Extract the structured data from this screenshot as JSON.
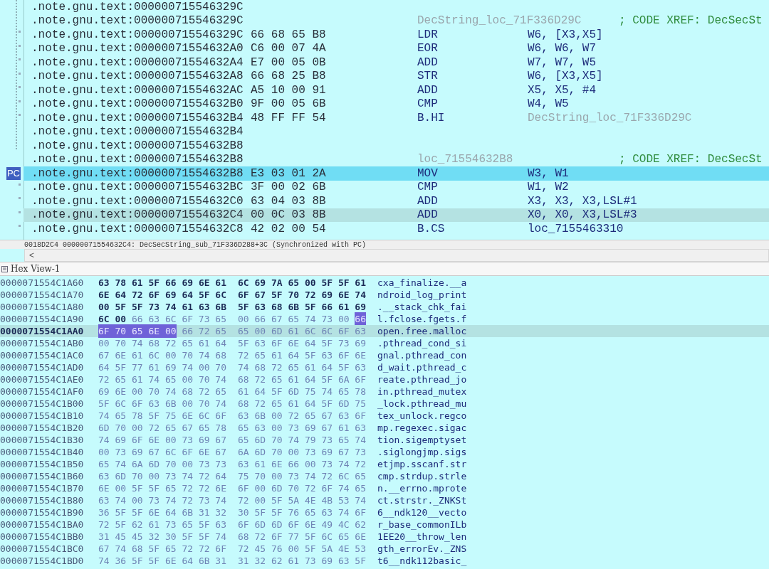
{
  "disassembly": {
    "pc_label": "PC",
    "rows": [
      {
        "address": ".note.gnu.text:000000715546329C",
        "marker": false,
        "pc": false,
        "selected": false
      },
      {
        "address": ".note.gnu.text:000000715546329C",
        "label": "DecString_loc_71F336D29C",
        "comment": "; CODE XREF: DecSecSt",
        "marker": false,
        "pc": false,
        "selected": false
      },
      {
        "address": ".note.gnu.text:000000715546329C",
        "bytes": "66 68 65 B8",
        "mnemonic": "LDR",
        "operand": {
          "text": "W6, [X3,X5]",
          "kind": "register"
        },
        "marker": true,
        "pc": false,
        "selected": false
      },
      {
        "address": ".note.gnu.text:00000071554632A0",
        "bytes": "C6 00 07 4A",
        "mnemonic": "EOR",
        "operand": {
          "text": "W6, W6, W7",
          "kind": "register"
        },
        "marker": true,
        "pc": false,
        "selected": false
      },
      {
        "address": ".note.gnu.text:00000071554632A4",
        "bytes": "E7 00 05 0B",
        "mnemonic": "ADD",
        "operand": {
          "text": "W7, W7, W5",
          "kind": "register"
        },
        "marker": true,
        "pc": false,
        "selected": false
      },
      {
        "address": ".note.gnu.text:00000071554632A8",
        "bytes": "66 68 25 B8",
        "mnemonic": "STR",
        "operand": {
          "text": "W6, [X3,X5]",
          "kind": "register"
        },
        "marker": true,
        "pc": false,
        "selected": false
      },
      {
        "address": ".note.gnu.text:00000071554632AC",
        "bytes": "A5 10 00 91",
        "mnemonic": "ADD",
        "operand": {
          "text": "X5, X5, #4",
          "kind": "register"
        },
        "marker": true,
        "pc": false,
        "selected": false
      },
      {
        "address": ".note.gnu.text:00000071554632B0",
        "bytes": "9F 00 05 6B",
        "mnemonic": "CMP",
        "operand": {
          "text": "W4, W5",
          "kind": "register"
        },
        "marker": true,
        "pc": false,
        "selected": false
      },
      {
        "address": ".note.gnu.text:00000071554632B4",
        "bytes": "48 FF FF 54",
        "mnemonic": "B.HI",
        "operand": {
          "text": "DecString_loc_71F336D29C",
          "kind": "reference"
        },
        "marker": true,
        "pc": false,
        "selected": false
      },
      {
        "address": ".note.gnu.text:00000071554632B4",
        "marker": false,
        "pc": false,
        "selected": false
      },
      {
        "address": ".note.gnu.text:00000071554632B8",
        "marker": false,
        "pc": false,
        "selected": false
      },
      {
        "address": ".note.gnu.text:00000071554632B8",
        "label": "loc_71554632B8",
        "comment": "; CODE XREF: DecSecSt",
        "marker": false,
        "pc": false,
        "selected": false
      },
      {
        "address": ".note.gnu.text:00000071554632B8",
        "bytes": "E3 03 01 2A",
        "mnemonic": "MOV",
        "operand": {
          "text": "W3, W1",
          "kind": "register"
        },
        "marker": false,
        "pc": true,
        "selected": false
      },
      {
        "address": ".note.gnu.text:00000071554632BC",
        "bytes": "3F 00 02 6B",
        "mnemonic": "CMP",
        "operand": {
          "text": "W1, W2",
          "kind": "register"
        },
        "marker": true,
        "pc": false,
        "selected": false
      },
      {
        "address": ".note.gnu.text:00000071554632C0",
        "bytes": "63 04 03 8B",
        "mnemonic": "ADD",
        "operand": {
          "text": "X3, X3, X3,LSL#1",
          "kind": "register"
        },
        "marker": true,
        "pc": false,
        "selected": false
      },
      {
        "address": ".note.gnu.text:00000071554632C4",
        "bytes": "00 0C 03 8B",
        "mnemonic": "ADD",
        "operand": {
          "text": "X0, X0, X3,LSL#3",
          "kind": "register"
        },
        "marker": true,
        "pc": false,
        "selected": true
      },
      {
        "address": ".note.gnu.text:00000071554632C8",
        "bytes": "42 02 00 54",
        "mnemonic": "B.CS",
        "operand": {
          "text": "loc_7155463310",
          "kind": "register"
        },
        "marker": true,
        "pc": false,
        "selected": false
      }
    ]
  },
  "status_line": "0018D2C4 00000071554632C4: DecSecString_sub_71F336D288+3C (Synchronized with PC)",
  "scroll_left": "<",
  "hex_view": {
    "title": "Hex View-1",
    "rows": [
      {
        "address": "0000071554C1A60",
        "left": [
          {
            "kind": "changed",
            "text": "63 78 61 5F 66 69 6E 61"
          }
        ],
        "right": [
          {
            "kind": "changed",
            "text": "6C 69 7A 65 00 5F 5F 61"
          }
        ],
        "ascii": "cxa_finalize.__a",
        "selected": false
      },
      {
        "address": "0000071554C1A70",
        "left": [
          {
            "kind": "changed",
            "text": "6E 64 72 6F 69 64 5F 6C"
          }
        ],
        "right": [
          {
            "kind": "changed",
            "text": "6F 67 5F 70 72 69 6E 74"
          }
        ],
        "ascii": "ndroid_log_print",
        "selected": false
      },
      {
        "address": "0000071554C1A80",
        "left": [
          {
            "kind": "changed",
            "text": "00 5F 5F 73 74 61 63 6B"
          }
        ],
        "right": [
          {
            "kind": "changed",
            "text": "5F 63 68 6B 5F 66 61 69"
          }
        ],
        "ascii": ".__stack_chk_fai",
        "selected": false
      },
      {
        "address": "0000071554C1A90",
        "left": [
          {
            "kind": "changed",
            "text": "6C 00"
          },
          {
            "kind": "normal",
            "text": "66 63 6C 6F 73 65"
          }
        ],
        "right": [
          {
            "kind": "normal",
            "text": "00 66 67 65 74 73 00"
          },
          {
            "kind": "selected",
            "text": "66"
          }
        ],
        "ascii": "l.fclose.fgets.f",
        "selected": false
      },
      {
        "address": "0000071554C1AA0",
        "left": [
          {
            "kind": "selected",
            "text": "6F 70 65 6E 00"
          },
          {
            "kind": "normal",
            "text": "66 72 65"
          }
        ],
        "right": [
          {
            "kind": "normal",
            "text": "65 00 6D 61 6C 6C 6F 63"
          }
        ],
        "ascii": "open.free.malloc",
        "selected": true
      },
      {
        "address": "0000071554C1AB0",
        "left": [
          {
            "kind": "normal",
            "text": "00 70 74 68 72 65 61 64"
          }
        ],
        "right": [
          {
            "kind": "normal",
            "text": "5F 63 6F 6E 64 5F 73 69"
          }
        ],
        "ascii": ".pthread_cond_si",
        "selected": false
      },
      {
        "address": "0000071554C1AC0",
        "left": [
          {
            "kind": "normal",
            "text": "67 6E 61 6C 00 70 74 68"
          }
        ],
        "right": [
          {
            "kind": "normal",
            "text": "72 65 61 64 5F 63 6F 6E"
          }
        ],
        "ascii": "gnal.pthread_con",
        "selected": false
      },
      {
        "address": "0000071554C1AD0",
        "left": [
          {
            "kind": "normal",
            "text": "64 5F 77 61 69 74 00 70"
          }
        ],
        "right": [
          {
            "kind": "normal",
            "text": "74 68 72 65 61 64 5F 63"
          }
        ],
        "ascii": "d_wait.pthread_c",
        "selected": false
      },
      {
        "address": "0000071554C1AE0",
        "left": [
          {
            "kind": "normal",
            "text": "72 65 61 74 65 00 70 74"
          }
        ],
        "right": [
          {
            "kind": "normal",
            "text": "68 72 65 61 64 5F 6A 6F"
          }
        ],
        "ascii": "reate.pthread_jo",
        "selected": false
      },
      {
        "address": "0000071554C1AF0",
        "left": [
          {
            "kind": "normal",
            "text": "69 6E 00 70 74 68 72 65"
          }
        ],
        "right": [
          {
            "kind": "normal",
            "text": "61 64 5F 6D 75 74 65 78"
          }
        ],
        "ascii": "in.pthread_mutex",
        "selected": false
      },
      {
        "address": "0000071554C1B00",
        "left": [
          {
            "kind": "normal",
            "text": "5F 6C 6F 63 6B 00 70 74"
          }
        ],
        "right": [
          {
            "kind": "normal",
            "text": "68 72 65 61 64 5F 6D 75"
          }
        ],
        "ascii": "_lock.pthread_mu",
        "selected": false
      },
      {
        "address": "0000071554C1B10",
        "left": [
          {
            "kind": "normal",
            "text": "74 65 78 5F 75 6E 6C 6F"
          }
        ],
        "right": [
          {
            "kind": "normal",
            "text": "63 6B 00 72 65 67 63 6F"
          }
        ],
        "ascii": "tex_unlock.regco",
        "selected": false
      },
      {
        "address": "0000071554C1B20",
        "left": [
          {
            "kind": "normal",
            "text": "6D 70 00 72 65 67 65 78"
          }
        ],
        "right": [
          {
            "kind": "normal",
            "text": "65 63 00 73 69 67 61 63"
          }
        ],
        "ascii": "mp.regexec.sigac",
        "selected": false
      },
      {
        "address": "0000071554C1B30",
        "left": [
          {
            "kind": "normal",
            "text": "74 69 6F 6E 00 73 69 67"
          }
        ],
        "right": [
          {
            "kind": "normal",
            "text": "65 6D 70 74 79 73 65 74"
          }
        ],
        "ascii": "tion.sigemptyset",
        "selected": false
      },
      {
        "address": "0000071554C1B40",
        "left": [
          {
            "kind": "normal",
            "text": "00 73 69 67 6C 6F 6E 67"
          }
        ],
        "right": [
          {
            "kind": "normal",
            "text": "6A 6D 70 00 73 69 67 73"
          }
        ],
        "ascii": ".siglongjmp.sigs",
        "selected": false
      },
      {
        "address": "0000071554C1B50",
        "left": [
          {
            "kind": "normal",
            "text": "65 74 6A 6D 70 00 73 73"
          }
        ],
        "right": [
          {
            "kind": "normal",
            "text": "63 61 6E 66 00 73 74 72"
          }
        ],
        "ascii": "etjmp.sscanf.str",
        "selected": false
      },
      {
        "address": "0000071554C1B60",
        "left": [
          {
            "kind": "normal",
            "text": "63 6D 70 00 73 74 72 64"
          }
        ],
        "right": [
          {
            "kind": "normal",
            "text": "75 70 00 73 74 72 6C 65"
          }
        ],
        "ascii": "cmp.strdup.strle",
        "selected": false
      },
      {
        "address": "0000071554C1B70",
        "left": [
          {
            "kind": "normal",
            "text": "6E 00 5F 5F 65 72 72 6E"
          }
        ],
        "right": [
          {
            "kind": "normal",
            "text": "6F 00 6D 70 72 6F 74 65"
          }
        ],
        "ascii": "n.__errno.mprote",
        "selected": false
      },
      {
        "address": "0000071554C1B80",
        "left": [
          {
            "kind": "normal",
            "text": "63 74 00 73 74 72 73 74"
          }
        ],
        "right": [
          {
            "kind": "normal",
            "text": "72 00 5F 5A 4E 4B 53 74"
          }
        ],
        "ascii": "ct.strstr._ZNKSt",
        "selected": false
      },
      {
        "address": "0000071554C1B90",
        "left": [
          {
            "kind": "normal",
            "text": "36 5F 5F 6E 64 6B 31 32"
          }
        ],
        "right": [
          {
            "kind": "normal",
            "text": "30 5F 5F 76 65 63 74 6F"
          }
        ],
        "ascii": "6__ndk120__vecto",
        "selected": false
      },
      {
        "address": "0000071554C1BA0",
        "left": [
          {
            "kind": "normal",
            "text": "72 5F 62 61 73 65 5F 63"
          }
        ],
        "right": [
          {
            "kind": "normal",
            "text": "6F 6D 6D 6F 6E 49 4C 62"
          }
        ],
        "ascii": "r_base_commonILb",
        "selected": false
      },
      {
        "address": "0000071554C1BB0",
        "left": [
          {
            "kind": "normal",
            "text": "31 45 45 32 30 5F 5F 74"
          }
        ],
        "right": [
          {
            "kind": "normal",
            "text": "68 72 6F 77 5F 6C 65 6E"
          }
        ],
        "ascii": "1EE20__throw_len",
        "selected": false
      },
      {
        "address": "0000071554C1BC0",
        "left": [
          {
            "kind": "normal",
            "text": "67 74 68 5F 65 72 72 6F"
          }
        ],
        "right": [
          {
            "kind": "normal",
            "text": "72 45 76 00 5F 5A 4E 53"
          }
        ],
        "ascii": "gth_errorEv._ZNS",
        "selected": false
      },
      {
        "address": "0000071554C1BD0",
        "left": [
          {
            "kind": "normal",
            "text": "74 36 5F 5F 6E 64 6B 31"
          }
        ],
        "right": [
          {
            "kind": "normal",
            "text": "31 32 62 61 73 69 63 5F"
          }
        ],
        "ascii": "t6__ndk112basic_",
        "selected": false
      }
    ]
  }
}
